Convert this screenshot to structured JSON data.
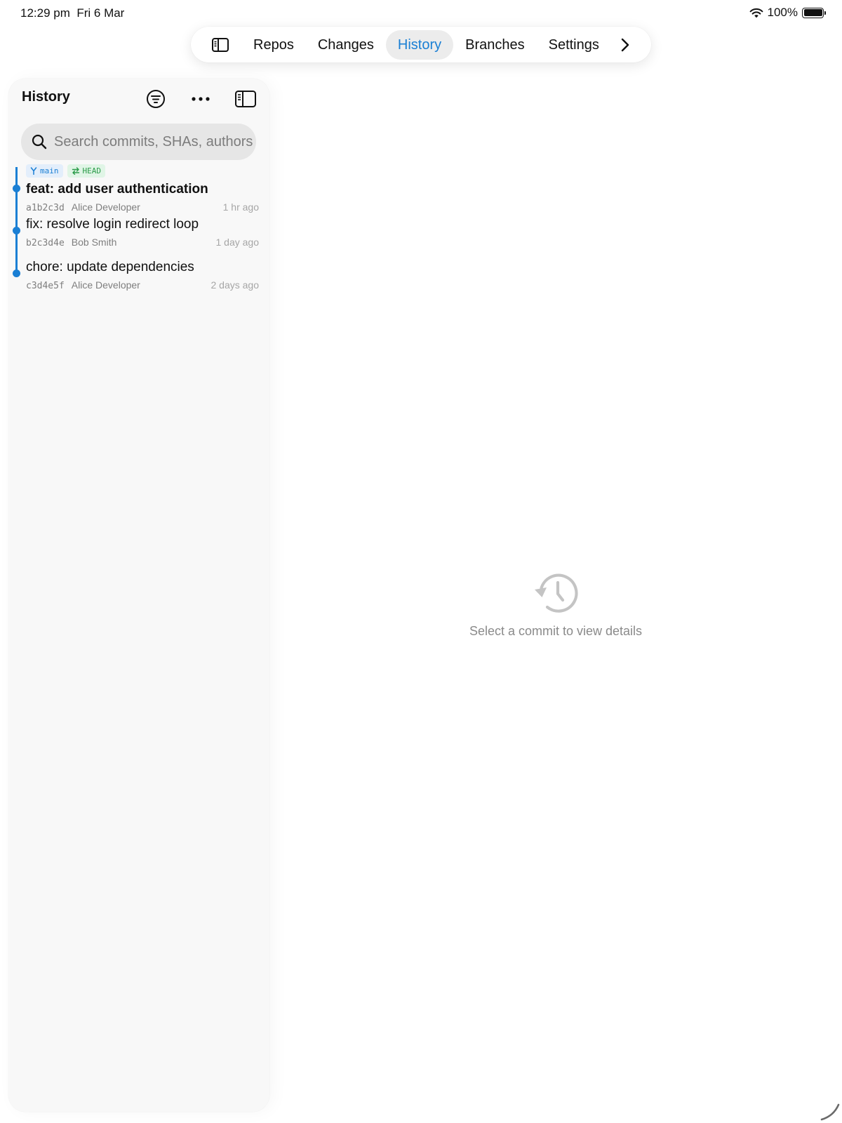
{
  "status_bar": {
    "time": "12:29 pm",
    "date": "Fri 6 Mar",
    "battery": "100%",
    "battery_level": 1.0
  },
  "tabbar": {
    "sidebar_icon": "sidebar-toggle-icon",
    "tabs": [
      {
        "label": "Repos",
        "active": false
      },
      {
        "label": "Changes",
        "active": false
      },
      {
        "label": "History",
        "active": true
      },
      {
        "label": "Branches",
        "active": false
      },
      {
        "label": "Settings",
        "active": false
      }
    ],
    "more_icon": "chevron-right-icon"
  },
  "sidebar": {
    "title": "History",
    "filter_icon": "filter-icon",
    "more_icon": "ellipsis-icon",
    "collapse_icon": "sidebar-collapse-icon",
    "search": {
      "placeholder": "Search commits, SHAs, authors",
      "value": ""
    },
    "commits": [
      {
        "message": "feat: add user authentication",
        "sha": "a1b2c3d",
        "author": "Alice Developer",
        "time": "1 hr ago",
        "refs": [
          {
            "type": "branch",
            "icon": "branch-icon",
            "label": "main"
          },
          {
            "type": "head",
            "icon": "arrows-swap-icon",
            "label": "HEAD"
          }
        ]
      },
      {
        "message": "fix: resolve login redirect loop",
        "sha": "b2c3d4e",
        "author": "Bob Smith",
        "time": "1 day ago",
        "refs": []
      },
      {
        "message": "chore: update dependencies",
        "sha": "c3d4e5f",
        "author": "Alice Developer",
        "time": "2 days ago",
        "refs": []
      }
    ]
  },
  "detail": {
    "icon": "history-clock-icon",
    "empty_text": "Select a commit to view details"
  },
  "colors": {
    "accent": "#1a7fd4",
    "head_green": "#2a9b48",
    "sidebar_bg": "#f8f8f8"
  }
}
